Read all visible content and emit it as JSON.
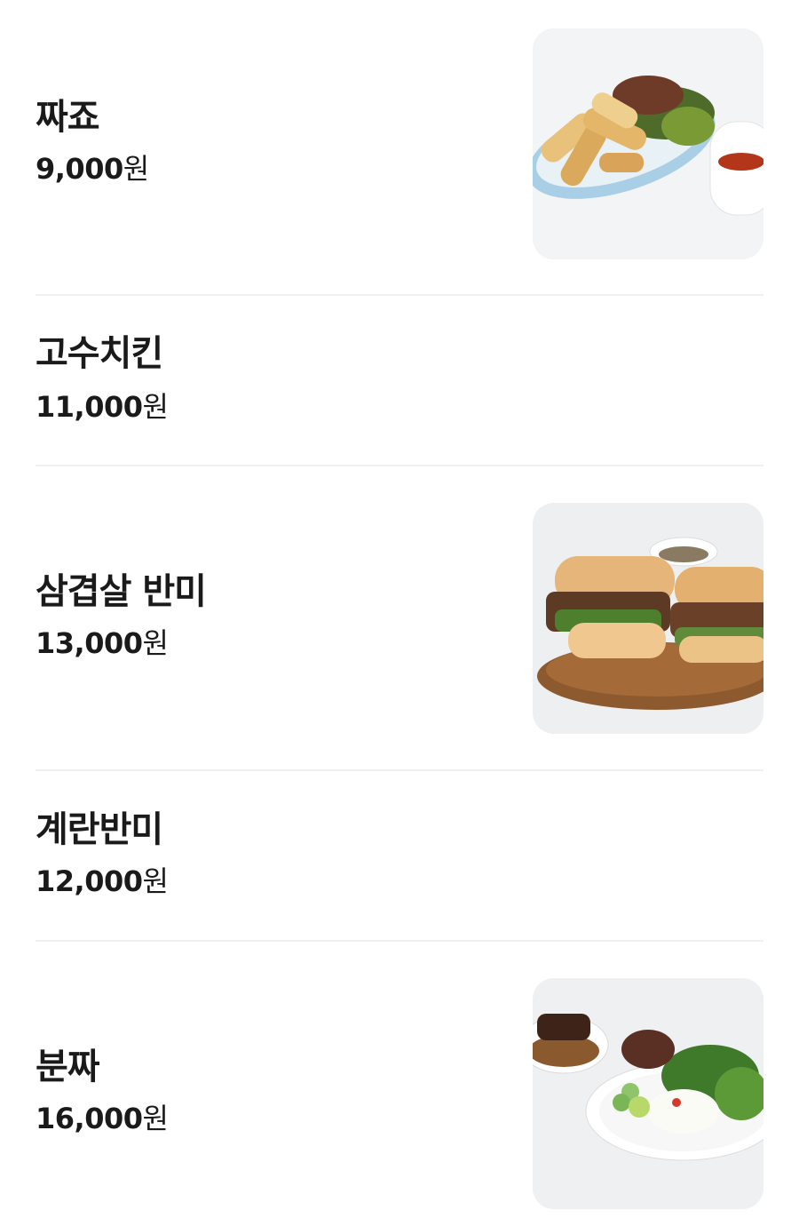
{
  "menu": {
    "items": [
      {
        "name": "짜죠",
        "price": "9,000",
        "currency": "원",
        "has_image": true,
        "image_label": "spring-rolls-photo"
      },
      {
        "name": "고수치킨",
        "price": "11,000",
        "currency": "원",
        "has_image": false
      },
      {
        "name": "삼겹살 반미",
        "price": "13,000",
        "currency": "원",
        "has_image": true,
        "image_label": "pork-belly-banh-mi-photo"
      },
      {
        "name": "계란반미",
        "price": "12,000",
        "currency": "원",
        "has_image": false
      },
      {
        "name": "분짜",
        "price": "16,000",
        "currency": "원",
        "has_image": true,
        "image_label": "bun-cha-photo"
      }
    ]
  }
}
